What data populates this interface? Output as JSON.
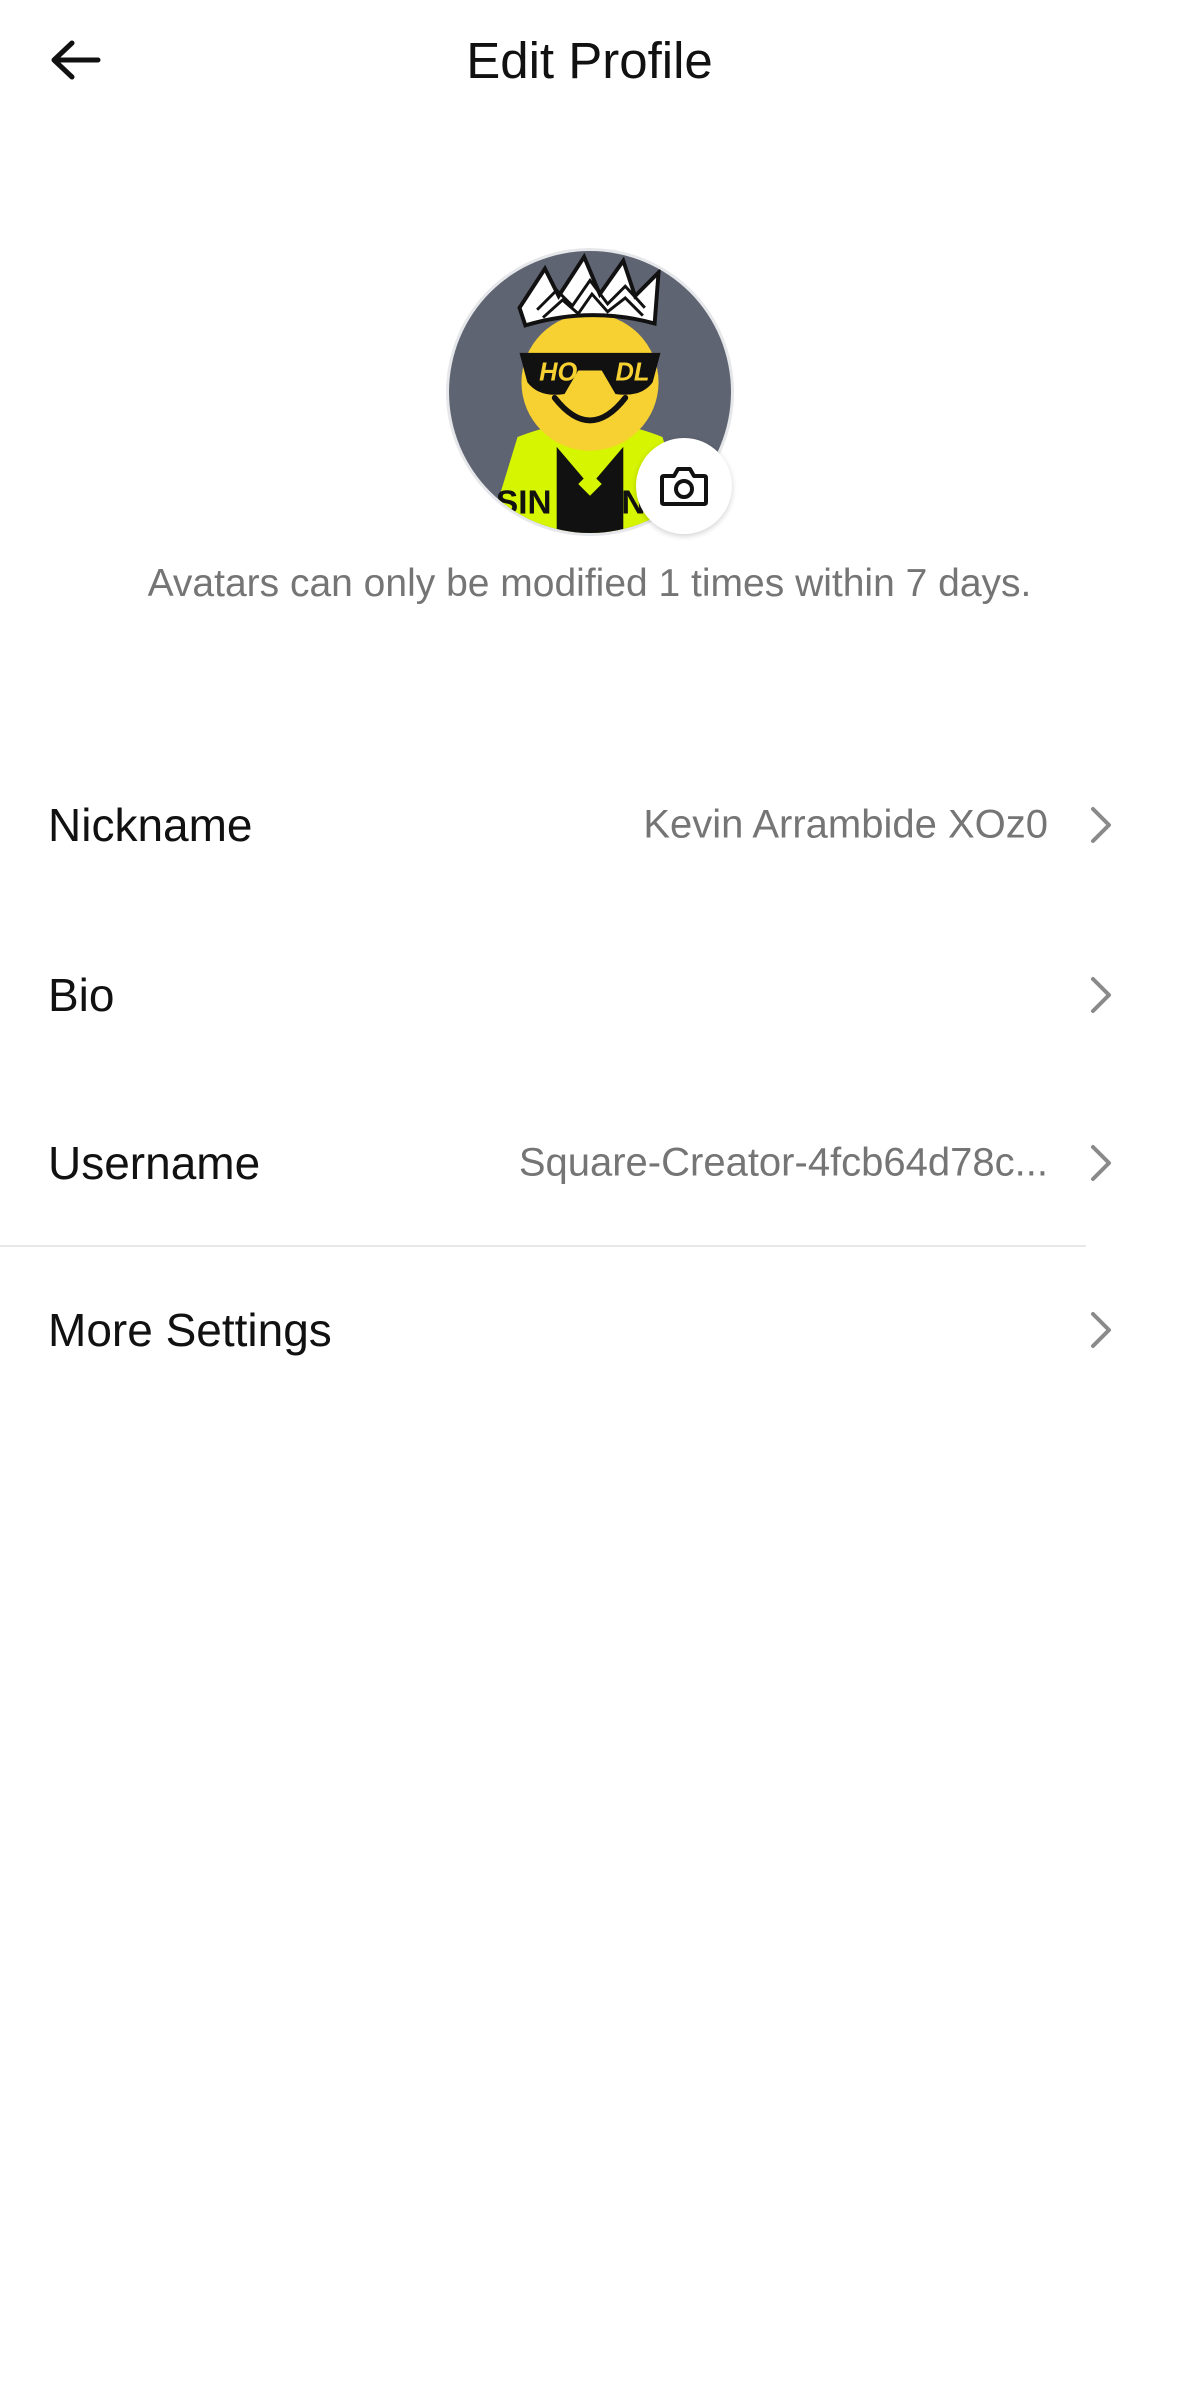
{
  "header": {
    "back_icon": "arrow-left-icon",
    "title": "Edit Profile"
  },
  "avatar": {
    "image_text_left": "HO",
    "image_text_right": "DL",
    "camera_icon": "camera-icon",
    "note": "Avatars can only be modified 1 times within 7 days."
  },
  "rows": [
    {
      "label": "Nickname",
      "value": "Kevin Arrambide XOz0"
    },
    {
      "label": "Bio",
      "value": ""
    },
    {
      "label": "Username",
      "value": "Square-Creator-4fcb64d78c..."
    },
    {
      "label": "More Settings",
      "value": ""
    }
  ],
  "colors": {
    "text_primary": "#111111",
    "text_secondary": "#757575",
    "divider": "#e8e8e8",
    "avatar_bg": "#5f6472",
    "avatar_face": "#f7d131",
    "avatar_accent": "#d6f500"
  }
}
